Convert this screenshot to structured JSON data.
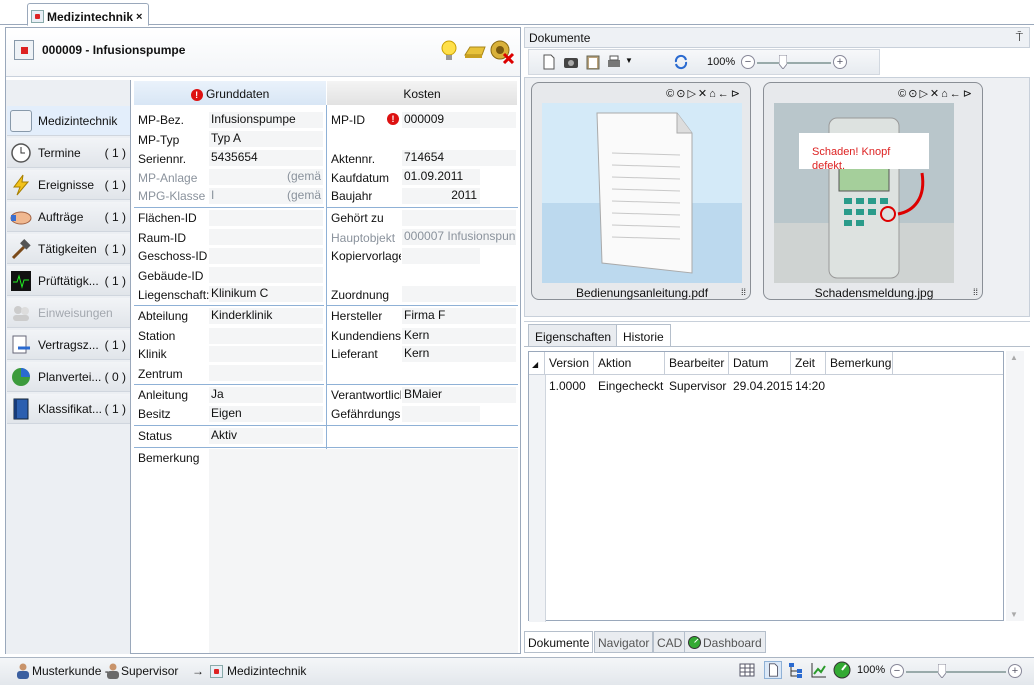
{
  "document_tab": {
    "label": "Medizintechnik",
    "close": "×"
  },
  "header": {
    "title": "000009 - Infusionspumpe"
  },
  "nav": {
    "items": [
      {
        "label": "Medizintechnik",
        "count": ""
      },
      {
        "label": "Termine",
        "count": "( 1 )"
      },
      {
        "label": "Ereignisse",
        "count": "( 1 )"
      },
      {
        "label": "Aufträge",
        "count": "( 1 )"
      },
      {
        "label": "Tätigkeiten",
        "count": "( 1 )"
      },
      {
        "label": "Prüftätigk...",
        "count": "( 1 )"
      },
      {
        "label": "Einweisungen",
        "count": ""
      },
      {
        "label": "Vertragsz...",
        "count": "( 1 )"
      },
      {
        "label": "Planvertei...",
        "count": "( 0 )"
      },
      {
        "label": "Klassifikat...",
        "count": "( 1 )"
      }
    ]
  },
  "form": {
    "tabs": [
      "Grunddaten",
      "Kosten"
    ],
    "left": {
      "mp_bez_label": "MP-Bez.",
      "mp_bez": "Infusionspumpe",
      "mp_typ_label": "MP-Typ",
      "mp_typ": "Typ A",
      "seriennr_label": "Seriennr.",
      "seriennr": "5435654",
      "mp_anlage_label": "MP-Anlage",
      "mp_anlage_hint": "(gemä",
      "mpg_klasse_label": "MPG-Klasse",
      "mpg_klasse": "I",
      "mpg_klasse_hint": "(gemä",
      "flaechen_label": "Flächen-ID",
      "raum_label": "Raum-ID",
      "geschoss_label": "Geschoss-ID",
      "gebaeude_label": "Gebäude-ID",
      "liegenschaft_label": "Liegenschaft:",
      "liegenschaft": "Klinikum C",
      "abteilung_label": "Abteilung",
      "abteilung": "Kinderklinik",
      "station_label": "Station",
      "klinik_label": "Klinik",
      "zentrum_label": "Zentrum",
      "anleitung_label": "Anleitung",
      "anleitung": "Ja",
      "besitz_label": "Besitz",
      "besitz": "Eigen",
      "status_label": "Status",
      "status": "Aktiv",
      "bemerkung_label": "Bemerkung"
    },
    "right": {
      "mp_id_label": "MP-ID",
      "mp_id": "000009",
      "aktennr_label": "Aktennr.",
      "aktennr": "714654",
      "kaufdatum_label": "Kaufdatum",
      "kaufdatum": "01.09.2011",
      "baujahr_label": "Baujahr",
      "baujahr": "2011",
      "gehoert_label": "Gehört zu",
      "hauptobjekt_label": "Hauptobjekt",
      "hauptobjekt": "000007 Infusionspun",
      "kopiervorlage_label": "Kopiervorlage",
      "zuordnung_label": "Zuordnung",
      "hersteller_label": "Hersteller",
      "hersteller": "Firma F",
      "kundendienst_label": "Kundendienst",
      "kundendienst": "Kern",
      "lieferant_label": "Lieferant",
      "lieferant": "Kern",
      "verantwortlich_label": "Verantwortlich",
      "verantwortlich": "BMaier",
      "gefaehrdung_label": "Gefährdungsk"
    }
  },
  "documents": {
    "title": "Dokumente",
    "pin": "⍑",
    "zoom": "100%",
    "card_controls": "©⊙▷✕⌂←⊳",
    "cards": [
      {
        "caption": "Bedienungsanleitung.pdf"
      },
      {
        "caption": "Schadensmeldung.jpg",
        "annotation": "Schaden! Knopf defekt."
      }
    ]
  },
  "props": {
    "tabs": [
      "Eigenschaften",
      "Historie"
    ],
    "columns": [
      "Version",
      "Aktion",
      "Bearbeiter",
      "Datum",
      "Zeit",
      "Bemerkung"
    ],
    "rows": [
      [
        "1.0000",
        "Eingecheckt",
        "Supervisor",
        "29.04.2015",
        "14:20",
        ""
      ]
    ]
  },
  "bottom_tabs": [
    "Dokumente",
    "Navigator",
    "CAD",
    "Dashboard"
  ],
  "status": {
    "user": "Musterkunde -",
    "role": "Supervisor",
    "arrow": "→",
    "module": "Medizintechnik",
    "zoom": "100%"
  }
}
